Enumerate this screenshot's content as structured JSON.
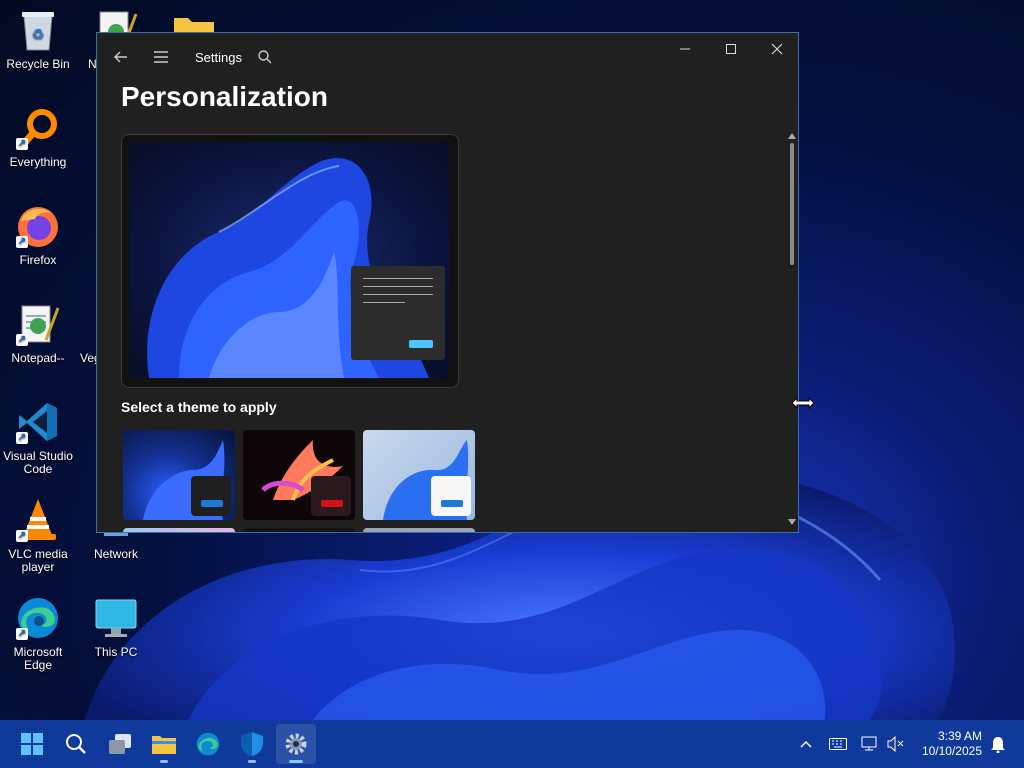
{
  "desktop": {
    "icons": [
      {
        "label": "Recycle Bin"
      },
      {
        "label": "Everything"
      },
      {
        "label": "Firefox"
      },
      {
        "label": "Notepad--"
      },
      {
        "label": "Visual Studio Code"
      },
      {
        "label": "VLC media player"
      },
      {
        "label": "Microsoft Edge"
      },
      {
        "label": "N"
      },
      {
        "label": "Veg"
      },
      {
        "label": "Network"
      },
      {
        "label": "This PC"
      }
    ]
  },
  "window": {
    "app_title": "Settings",
    "page_title": "Personalization",
    "section_label": "Select a theme to apply",
    "themes": [
      {
        "name": "dark-blue-bloom",
        "accent": "#1e78d7"
      },
      {
        "name": "glow-flower",
        "accent": "#d40f1c"
      },
      {
        "name": "light-bloom",
        "accent": "#1e78d7"
      }
    ]
  },
  "taskbar": {
    "apps": [
      "start",
      "search",
      "task-view",
      "file-explorer",
      "edge",
      "defender",
      "settings"
    ],
    "clock": {
      "time": "3:39 AM",
      "date": "10/10/2025"
    }
  },
  "colors": {
    "taskbar_bg": "#0f3a9c",
    "window_bg": "#202020",
    "accent": "#4cc2ff"
  }
}
